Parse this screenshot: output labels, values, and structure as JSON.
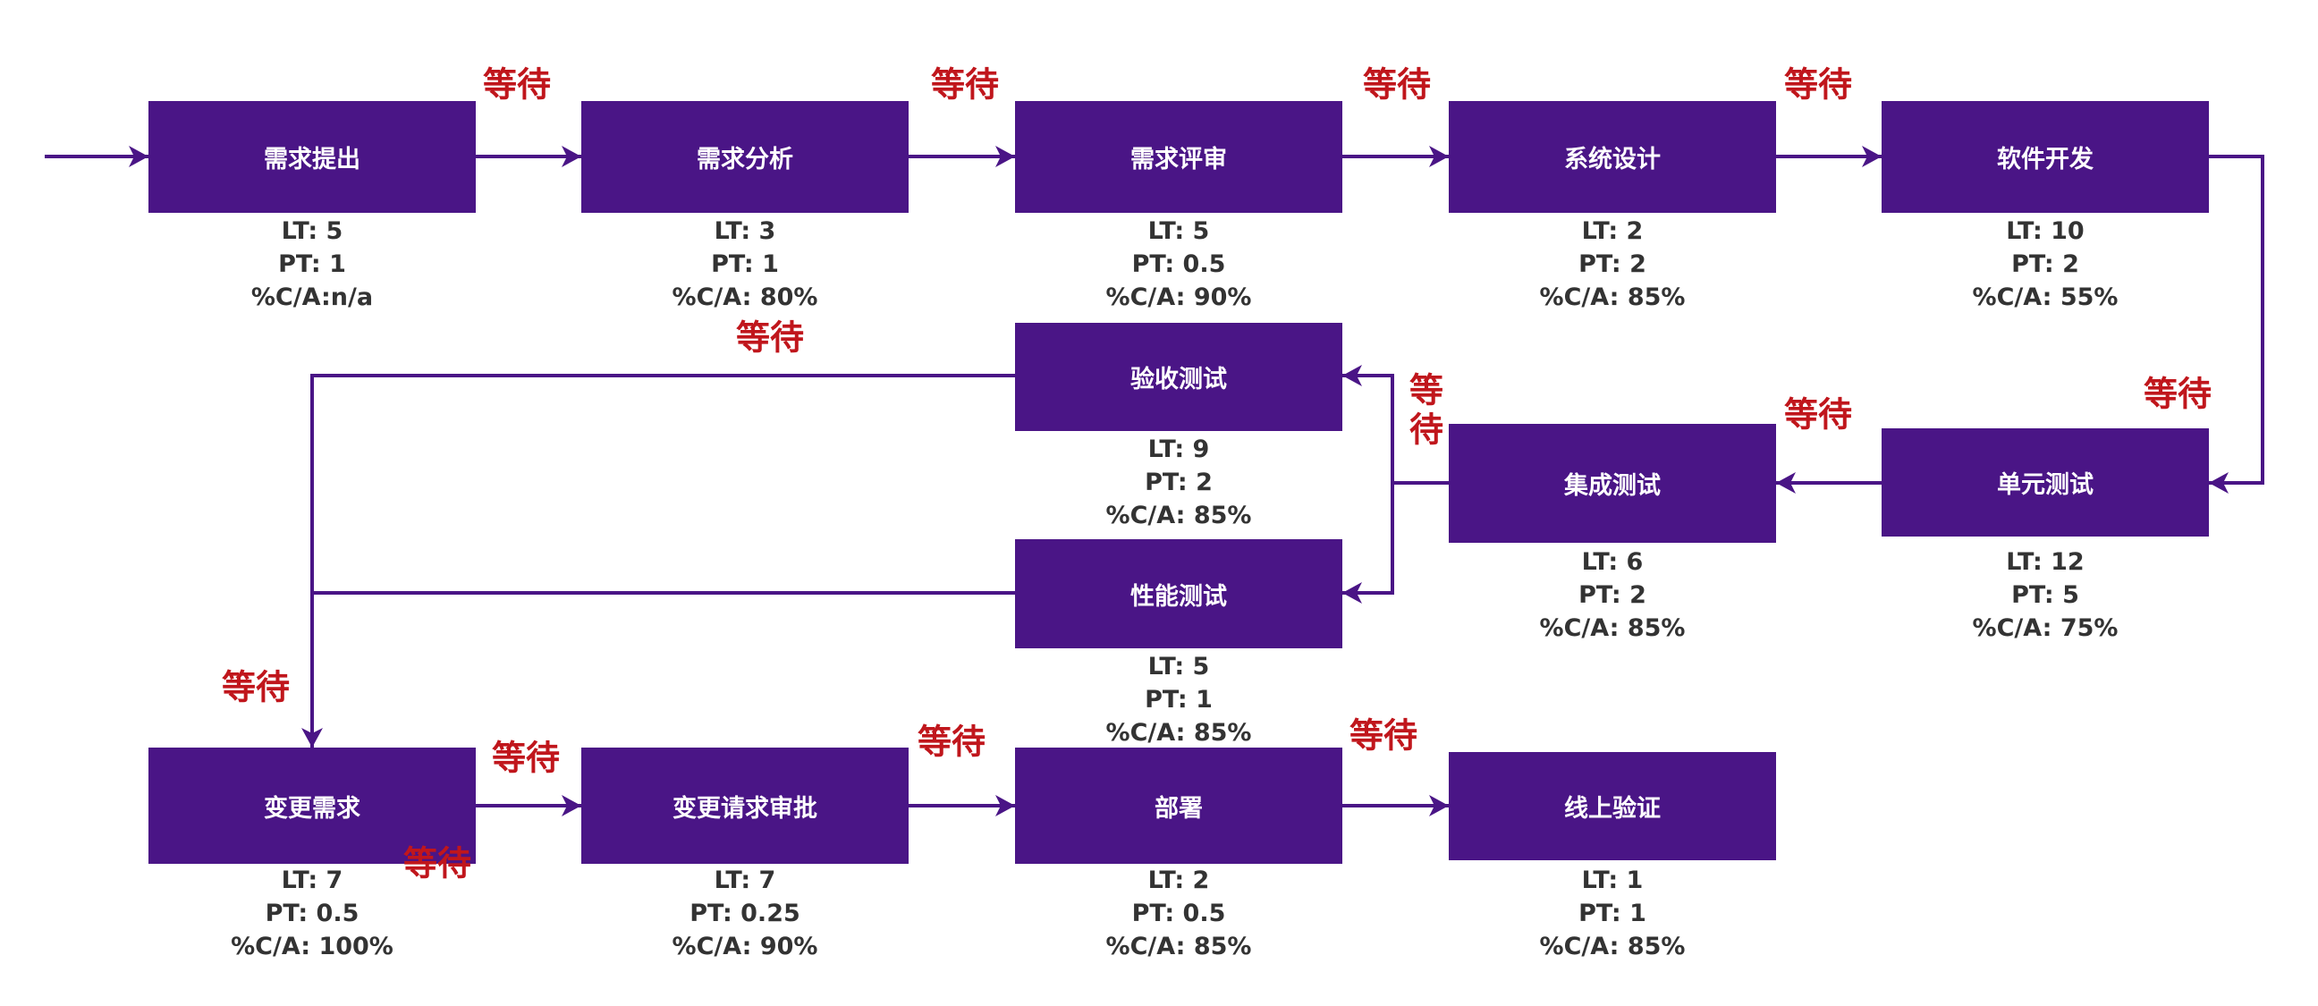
{
  "steps": [
    {
      "name": "需求提出",
      "lt": "LT: 5",
      "pt": "PT: 1",
      "ca": "%C/A:n/a"
    },
    {
      "name": "需求分析",
      "lt": "LT: 3",
      "pt": "PT: 1",
      "ca": "%C/A: 80%"
    },
    {
      "name": "需求评审",
      "lt": "LT: 5",
      "pt": "PT: 0.5",
      "ca": "%C/A: 90%"
    },
    {
      "name": "系统设计",
      "lt": "LT: 2",
      "pt": "PT: 2",
      "ca": "%C/A: 85%"
    },
    {
      "name": "软件开发",
      "lt": "LT: 10",
      "pt": "PT: 2",
      "ca": "%C/A: 55%"
    },
    {
      "name": "单元测试",
      "lt": "LT: 12",
      "pt": "PT: 5",
      "ca": "%C/A: 75%"
    },
    {
      "name": "集成测试",
      "lt": "LT: 6",
      "pt": "PT: 2",
      "ca": "%C/A: 85%"
    },
    {
      "name": "验收测试",
      "lt": "LT: 9",
      "pt": "PT: 2",
      "ca": "%C/A: 85%"
    },
    {
      "name": "性能测试",
      "lt": "LT: 5",
      "pt": "PT: 1",
      "ca": "%C/A: 85%"
    },
    {
      "name": "变更需求",
      "lt": "LT: 7",
      "pt": "PT: 0.5",
      "ca": "%C/A: 100%"
    },
    {
      "name": "变更请求审批",
      "lt": "LT: 7",
      "pt": "PT: 0.25",
      "ca": "%C/A: 90%"
    },
    {
      "name": "部署",
      "lt": "LT: 2",
      "pt": "PT: 0.5",
      "ca": "%C/A: 85%"
    },
    {
      "name": "线上验证",
      "lt": "LT: 1",
      "pt": "PT: 1",
      "ca": "%C/A: 85%"
    }
  ],
  "wait_label": "等待",
  "colors": {
    "box": "#4a1586",
    "wait": "#c0161c",
    "metrics": "#333333"
  }
}
